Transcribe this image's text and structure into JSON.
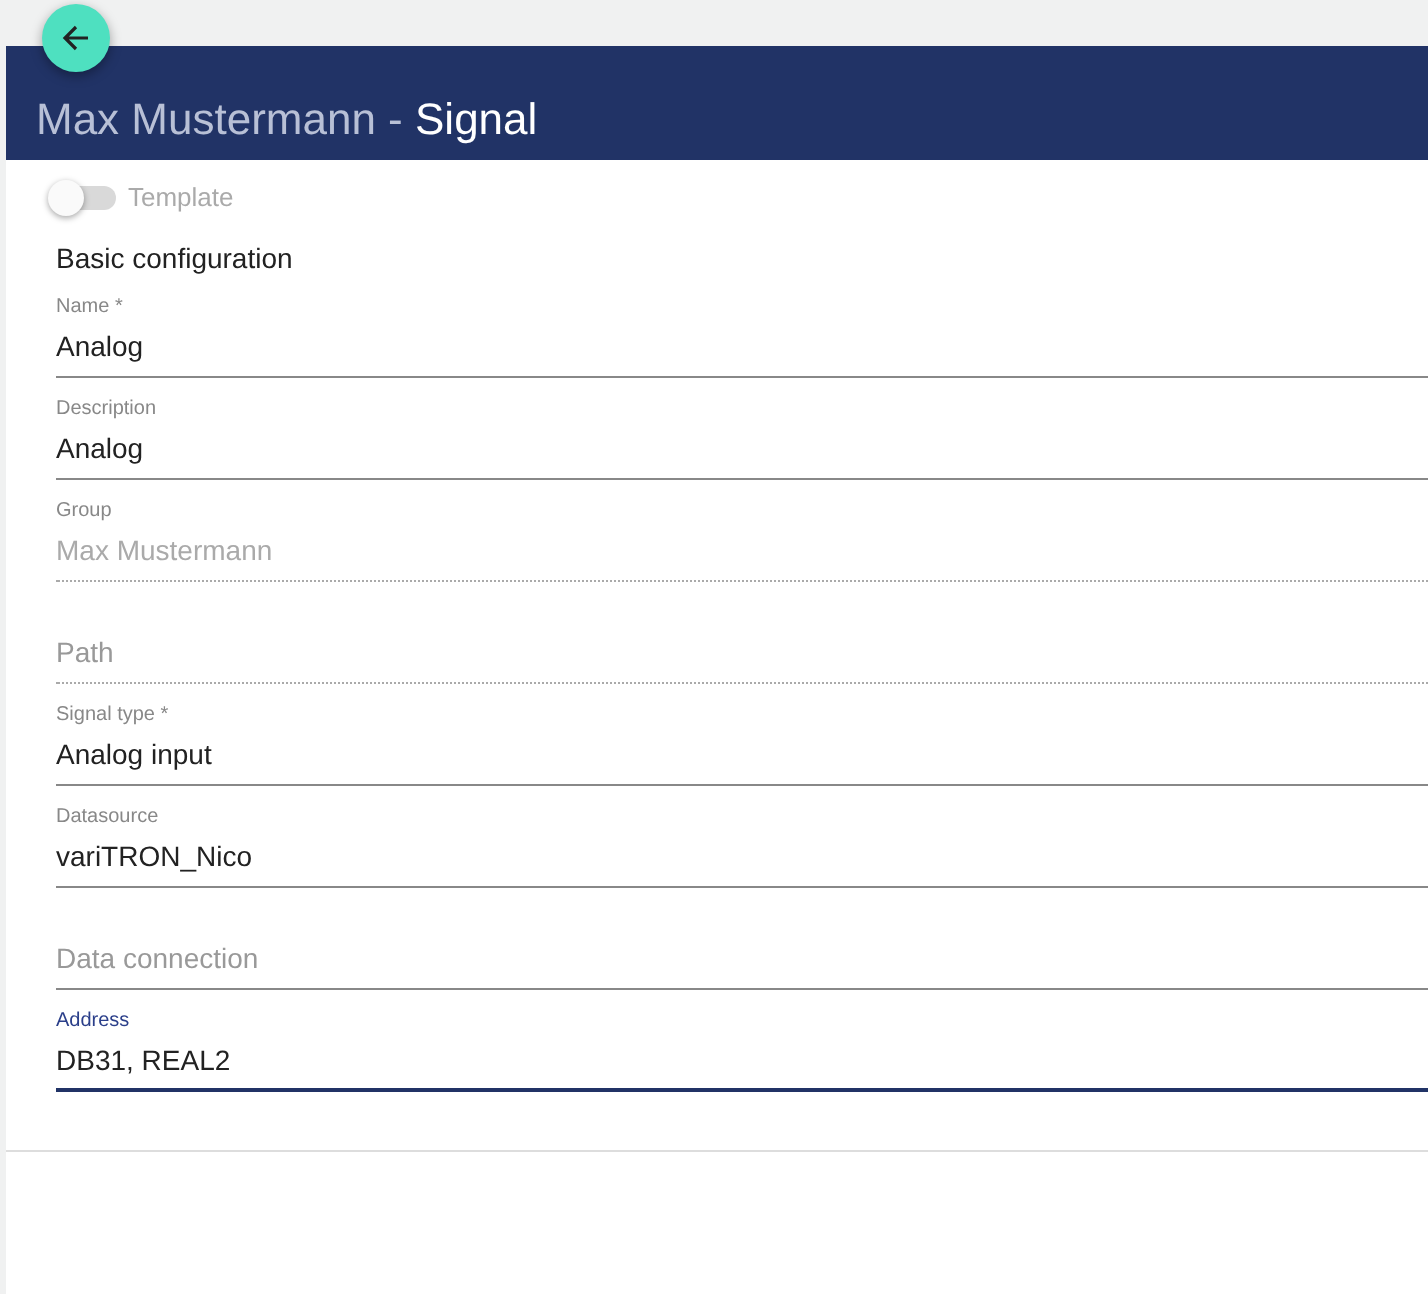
{
  "header": {
    "title_context": "Max Mustermann -",
    "title": "Signal"
  },
  "template_toggle": {
    "label": "Template",
    "on": false,
    "disabled": true
  },
  "section_title": "Basic configuration",
  "fields": [
    {
      "label": "Name *",
      "value": "Analog",
      "disabled": false,
      "focused": false
    },
    {
      "label": "Description",
      "value": "Analog",
      "disabled": false,
      "focused": false
    },
    {
      "label": "Group",
      "value": "Max Mustermann",
      "disabled": true,
      "focused": false
    },
    {
      "placeholder": "Path",
      "disabled": true,
      "focused": false
    },
    {
      "label": "Signal type *",
      "value": "Analog input",
      "disabled": false,
      "focused": false
    },
    {
      "label": "Datasource",
      "value": "variTRON_Nico",
      "disabled": false,
      "focused": false
    },
    {
      "placeholder": "Data connection",
      "disabled": false,
      "focused": false
    },
    {
      "label": "Address",
      "value": "DB31, REAL2",
      "disabled": false,
      "focused": true
    }
  ]
}
